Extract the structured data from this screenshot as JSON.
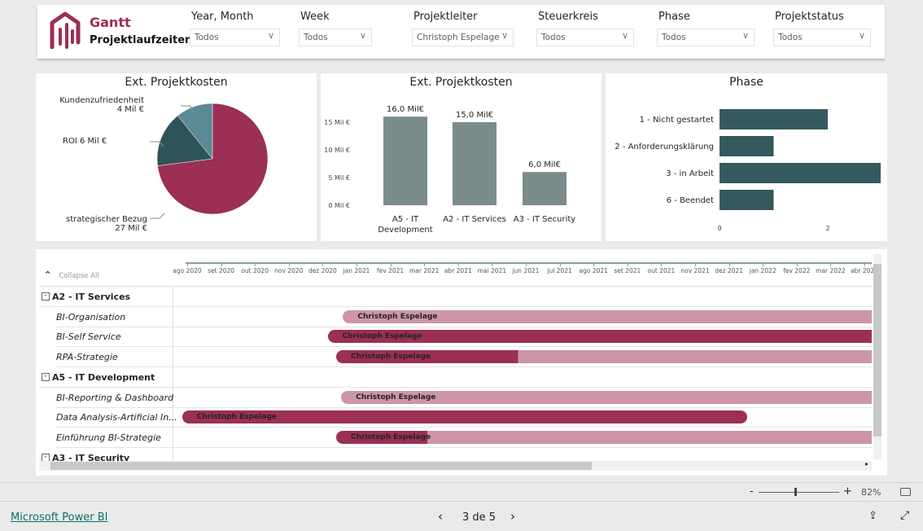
{
  "header": {
    "title": "Gantt",
    "subtitle": "Projektlaufzeiten",
    "brand_color": "#9b2f55"
  },
  "slicers": [
    {
      "label": "Year, Month",
      "value": "Todos"
    },
    {
      "label": "Week",
      "value": "Todos"
    },
    {
      "label": "Projektleiter",
      "value": "Christoph Espelage"
    },
    {
      "label": "Steuerkreis",
      "value": "Todos"
    },
    {
      "label": "Phase",
      "value": "Todos"
    },
    {
      "label": "Projektstatus",
      "value": "Todos"
    }
  ],
  "chart_data": [
    {
      "type": "pie",
      "title": "Ext. Projektkosten",
      "slices": [
        {
          "label": "strategischer Bezug",
          "value": 27,
          "value_label": "27 Mil €",
          "color": "#9b2f55"
        },
        {
          "label": "ROI",
          "value": 6,
          "value_label": "6 Mil €",
          "color": "#2f5457"
        },
        {
          "label": "Kundenzufriedenheit",
          "value": 4,
          "value_label": "4 Mil €",
          "color": "#5a8a96"
        }
      ]
    },
    {
      "type": "bar",
      "title": "Ext. Projektkosten",
      "categories": [
        "A5 - IT Development",
        "A2 - IT Services",
        "A3 - IT Security"
      ],
      "values": [
        16,
        15,
        6
      ],
      "data_labels": [
        "16,0 Mil€",
        "15,0 Mil€",
        "6,0 Mil€"
      ],
      "ylim": [
        0,
        17
      ],
      "yticks": [
        "0 Mil €",
        "5 Mil €",
        "10 Mil €",
        "15 Mil €"
      ],
      "color": "#7a8c8c"
    },
    {
      "type": "bar",
      "orientation": "horizontal",
      "title": "Phase",
      "categories": [
        "1 - Nicht gestartet",
        "2 - Anforderungsklärung",
        "3 - in Arbeit",
        "6 - Beendet"
      ],
      "values": [
        2,
        1,
        3,
        1
      ],
      "xlim": [
        0,
        3
      ],
      "xticks": [
        "0",
        "2"
      ],
      "color": "#355a5e"
    }
  ],
  "gantt": {
    "collapse_label": "Collapse All",
    "months": [
      "ago 2020",
      "set 2020",
      "out 2020",
      "nov 2020",
      "dez 2020",
      "jan 2021",
      "fev 2021",
      "mar 2021",
      "abr 2021",
      "mai 2021",
      "jun 2021",
      "jul 2021",
      "ago 2021",
      "set 2021",
      "out 2021",
      "nov 2021",
      "dez 2021",
      "jan 2022",
      "fev 2022",
      "mar 2022",
      "abr 2022"
    ],
    "groups": [
      {
        "name": "A2 - IT Services",
        "rows": [
          {
            "name": "BI-Organisation",
            "owner": "Christoph Espelage",
            "start": 4.6,
            "end": 20.3,
            "progress": 0
          },
          {
            "name": "BI-Self Service",
            "owner": "Christoph Espelage",
            "start": 4.15,
            "end": 20.3,
            "progress": 1
          },
          {
            "name": "RPA-Strategie",
            "owner": "Christoph Espelage",
            "start": 4.4,
            "end": 20.3,
            "progress": 0.34
          }
        ]
      },
      {
        "name": "A5 - IT Development",
        "rows": [
          {
            "name": "BI-Reporting & Dashboard",
            "owner": "Christoph Espelage",
            "start": 4.55,
            "end": 20.3,
            "progress": 0
          },
          {
            "name": "Data Analysis-Artificial In...",
            "owner": "Christoph Espelage",
            "start": -0.15,
            "end": 16.55,
            "progress": 1
          },
          {
            "name": "Einführung BI-Strategie",
            "owner": "Christoph Espelage",
            "start": 4.4,
            "end": 20.3,
            "progress": 0.17
          }
        ]
      },
      {
        "name": "A3 - IT Security",
        "rows": []
      }
    ],
    "colors": {
      "done": "#9b2f55",
      "remaining": "#cc95aa"
    }
  },
  "zoom": {
    "value": "82%",
    "level": 0.45
  },
  "footer": {
    "link": "Microsoft Power BI",
    "page": "3 de 5"
  }
}
